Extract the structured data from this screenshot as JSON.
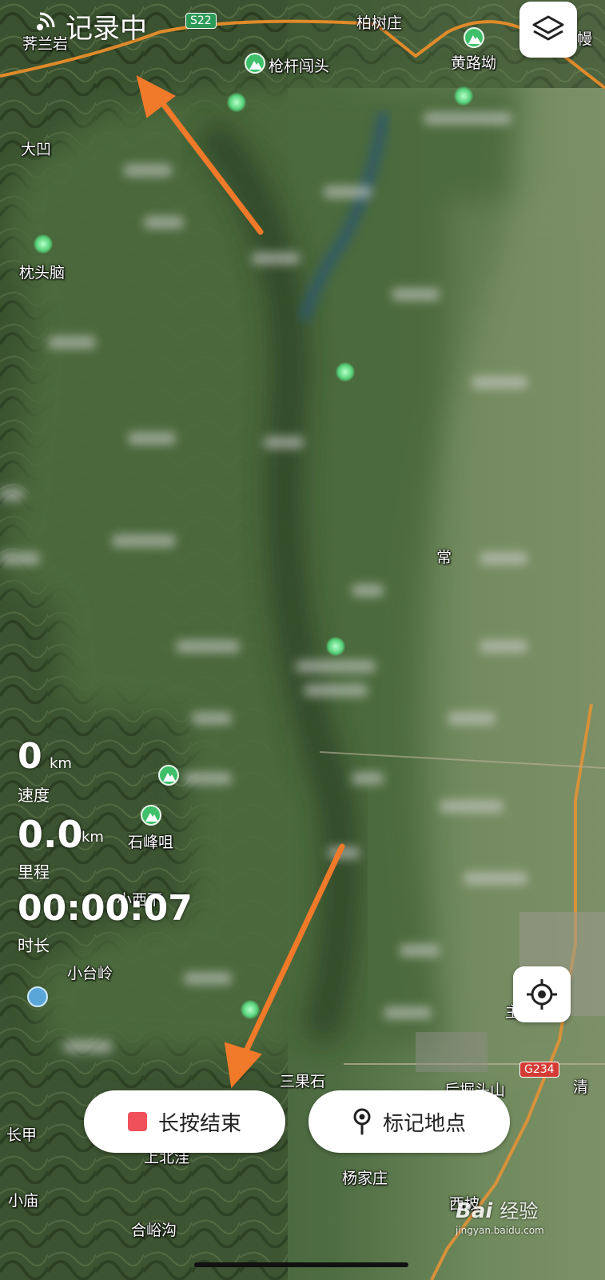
{
  "status": {
    "recording_text": "记录中"
  },
  "map_labels": {
    "jilanyan": "荠兰岩",
    "baishuzhuang": "柏树庄",
    "qianganchuangtou": "枪杆闯头",
    "huangluwa": "黄路坳",
    "man": "幔",
    "daao": "大凹",
    "zhentounao": "枕头脑",
    "chang": "常",
    "shifengju": "石峰咀",
    "xiaoxixia": "小西下",
    "xiaotailing": "小台岭",
    "sanguoshi": "三果石",
    "houjuetoushan": "后掘头山",
    "qing": "清",
    "changjia": "长甲",
    "shangbeiwa": "上北洼",
    "yangjiazhuang": "杨家庄",
    "xiaomiao": "小庙",
    "xipo": "西坡",
    "heyugou": "合峪沟",
    "shuzi": "主"
  },
  "road_badges": {
    "s22": "S22",
    "g234": "G234"
  },
  "stats": {
    "speed_value": "0",
    "speed_unit": "km",
    "speed_label": "速度",
    "distance_value": "0.0",
    "distance_unit": "km",
    "distance_label": "里程",
    "duration_value": "00:00:07",
    "duration_label": "时长"
  },
  "buttons": {
    "end_label": "长按结束",
    "mark_label": "标记地点"
  },
  "watermark": {
    "brand": "Bai",
    "brand2": "经验",
    "url": "jingyan.baidu.com"
  },
  "icons": {
    "recording": "signal-icon",
    "layers": "layers-icon",
    "locate": "locate-icon",
    "stop": "stop-square-icon",
    "pin": "map-pin-icon",
    "poi": "mountain-icon"
  },
  "colors": {
    "accent_arrow": "#f07a2a",
    "stop_red": "#f0505a",
    "poi_green": "#3fbf6a"
  }
}
